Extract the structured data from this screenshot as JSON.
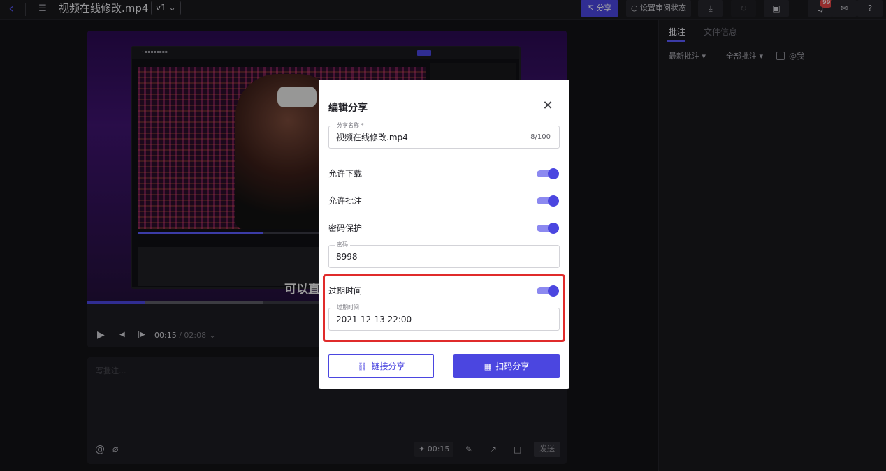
{
  "header": {
    "back_icon": "chevron-left-icon",
    "menu_icon": "list-icon",
    "file_title": "视频在线修改.mp4",
    "version": "v1",
    "share_label": "分享",
    "review_status_label": "设置审阅状态",
    "notification_count": "99",
    "help_label": "?"
  },
  "right_panel": {
    "tabs": [
      "批注",
      "文件信息"
    ],
    "filters": [
      "最新批注",
      "全部批注"
    ],
    "mention_label": "@我"
  },
  "player": {
    "subtitle": "可以直",
    "current_time": "00:15",
    "separator": " / ",
    "duration": "02:08",
    "progress_fraction": 0.12,
    "buffer_fraction": 0.367
  },
  "comment_box": {
    "placeholder": "写批注...",
    "timestamp": "00:15",
    "send_label": "发送"
  },
  "dialog": {
    "title": "编辑分享",
    "name_label": "分享名称 *",
    "name_value": "视频在线修改.mp4",
    "name_count": "8/100",
    "allow_download": "允许下载",
    "allow_comment": "允许批注",
    "password_protect": "密码保护",
    "password_label": "密码",
    "password_value": "8998",
    "expiry_toggle_label": "过期时间",
    "expiry_field_label": "过期时间",
    "expiry_value": "2021-12-13 22:00",
    "link_share_label": "链接分享",
    "qr_share_label": "扫码分享"
  },
  "colors": {
    "accent": "#4b46e0",
    "highlight": "#e02b2b"
  }
}
